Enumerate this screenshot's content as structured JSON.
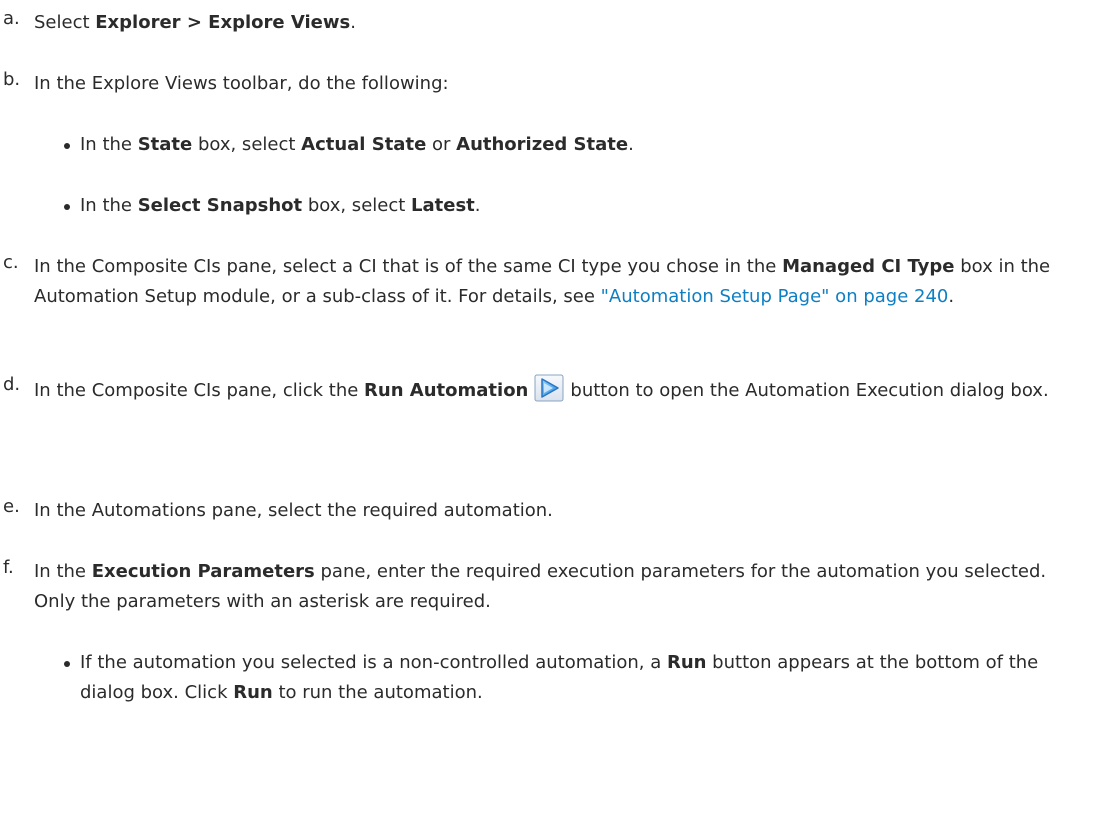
{
  "steps": {
    "a": {
      "marker": "a.",
      "t1": "Select ",
      "b1": "Explorer > Explore Views",
      "t2": "."
    },
    "b": {
      "marker": "b.",
      "t1": "In the Explore Views toolbar, do the following:",
      "bullets": [
        {
          "t1": "In the ",
          "b1": "State",
          "t2": " box, select ",
          "b2": "Actual State",
          "t3": " or ",
          "b3": "Authorized State",
          "t4": "."
        },
        {
          "t1": "In the ",
          "b1": "Select Snapshot",
          "t2": " box, select ",
          "b2": "Latest",
          "t3": "."
        }
      ]
    },
    "c": {
      "marker": "c.",
      "t1": "In the Composite CIs pane, select a CI that is of the same CI type you chose in the ",
      "b1": "Managed CI Type",
      "t2": " box in the Automation Setup module, or a sub-class of it. For details, see ",
      "link": "\"Automation Setup Page\" on page 240",
      "t3": "."
    },
    "d": {
      "marker": "d.",
      "t1": "In the Composite CIs pane, click the ",
      "b1": "Run Automation",
      "icon": "run-automation-icon",
      "t2": "button to open the Automation Execution dialog box."
    },
    "e": {
      "marker": "e.",
      "t1": "In the Automations pane, select the required automation."
    },
    "f": {
      "marker": "f.",
      "t1": "In the ",
      "b1": "Execution Parameters",
      "t2": " pane, enter the required execution parameters for the automation you selected. Only the parameters with an asterisk are required.",
      "bullets": [
        {
          "t1": "If the automation you selected is a non-controlled automation, a ",
          "b1": "Run",
          "t2": " button appears at the bottom of the dialog box. Click ",
          "b2": "Run",
          "t3": " to run the automation."
        }
      ]
    }
  },
  "colors": {
    "text": "#2b2b2b",
    "link": "#0d7fc4"
  }
}
